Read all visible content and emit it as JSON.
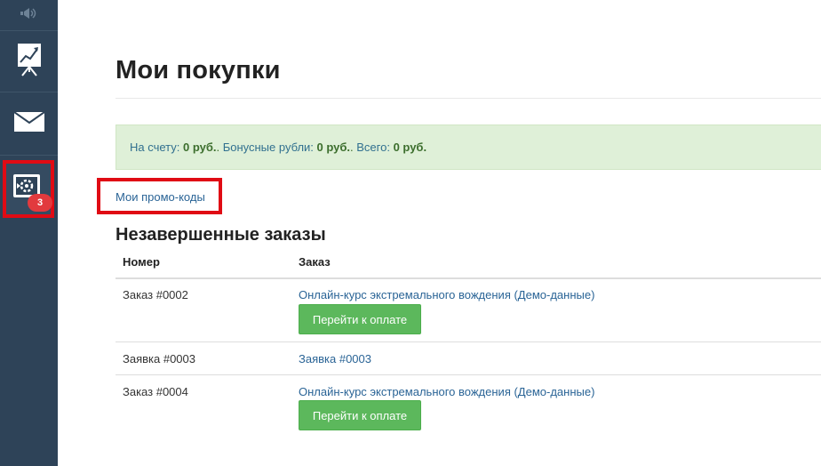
{
  "sidebar": {
    "items": [
      {
        "icon": "speaker-icon"
      },
      {
        "icon": "chart-board-icon"
      },
      {
        "icon": "envelope-icon"
      },
      {
        "icon": "screen-gear-icon",
        "badge": "3"
      }
    ]
  },
  "page": {
    "title": "Мои покупки"
  },
  "balance": {
    "account_label": "На счету: ",
    "account_value": "0 руб.",
    "bonus_label": " Бонусные рубли: ",
    "bonus_value": "0 руб.",
    "total_label": " Всего: ",
    "total_value": "0 руб."
  },
  "promo_link": "Мои промо-коды",
  "section": {
    "title": "Незавершенные заказы"
  },
  "table": {
    "headers": [
      "Номер",
      "Заказ"
    ],
    "rows": [
      {
        "number": "Заказ #0002",
        "order": "Онлайн-курс экстремального вождения (Демо-данные)",
        "button": "Перейти к оплате"
      },
      {
        "number": "Заявка #0003",
        "order": "Заявка #0003"
      },
      {
        "number": "Заказ #0004",
        "order": "Онлайн-курс экстремального вождения (Демо-данные)",
        "button": "Перейти к оплате"
      }
    ]
  },
  "colors": {
    "sidebar": "#2e4358",
    "highlight": "#e00b14",
    "success_bg": "#dff0d8",
    "button": "#5cb85c",
    "link": "#2a6496"
  }
}
